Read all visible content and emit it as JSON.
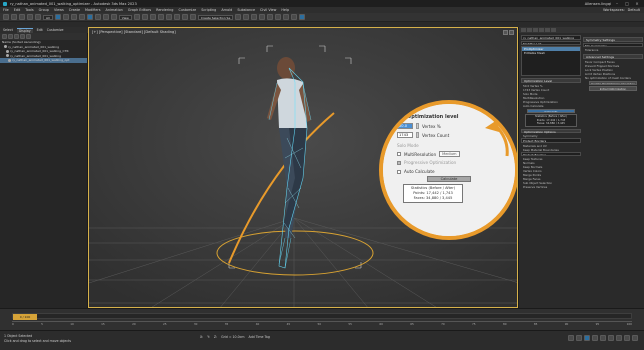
{
  "window": {
    "title": "ry_nathan_animated_001_walking_optimizer - Autodesk 3ds Max 2023",
    "user": "Allensen.lingqi"
  },
  "menu": [
    "File",
    "Edit",
    "Tools",
    "Group",
    "Views",
    "Create",
    "Modifiers",
    "Animation",
    "Graph Editors",
    "Rendering",
    "Customize",
    "Scripting",
    "Arnold",
    "Substance",
    "Civil View",
    "Help"
  ],
  "workspace": {
    "label": "Workspaces:",
    "value": "Default"
  },
  "toolbar": {
    "filter": "All",
    "view": "View",
    "selection_set": "Create Selection Se"
  },
  "left_tabs": [
    "Select",
    "Display",
    "Edit",
    "Customize"
  ],
  "scene_explorer": {
    "rows": [
      {
        "label": "Name (Sorted Ascending)",
        "selected": false
      },
      {
        "label": "ry_nathan_animated_001_walking",
        "selected": false
      },
      {
        "label": "ry_nathan_animated_001_walking_CTR",
        "selected": false
      },
      {
        "label": "ry_nathan_animated_001_walking",
        "selected": false
      },
      {
        "label": "ry_nathan_animated_001_walking_opt",
        "selected": true
      }
    ]
  },
  "viewport": {
    "label": "[+] [Perspective] [Standard] [Default Shading]"
  },
  "callout": {
    "heading": "Optimization level",
    "vertex_percent": {
      "value": "50.0",
      "label": "Vertex %"
    },
    "vertex_count": {
      "value": "1743",
      "label": "Vertex Count"
    },
    "solo_mode": "Solo Mode",
    "multires": {
      "label": "MultiResolution",
      "level": "Medium"
    },
    "progressive": "Progressive Optimization",
    "auto_calc": "Auto Calculate",
    "calc_button": "Calculate",
    "stats": {
      "title": "Statistics (Before / After)",
      "points": "Points: 17,442 / 1,743",
      "faces": "Faces: 34,880 / 3,445"
    }
  },
  "command_panel": {
    "object_name": "ry_nathan_animated_001_walking",
    "modifier_list": "Modifier List",
    "modifiers": [
      {
        "label": "ProOptimizer",
        "selected": true
      },
      {
        "label": "Editable Mesh",
        "selected": false
      }
    ],
    "rollouts": {
      "optimization": "Optimization Level",
      "vertex_pct_label": "Vertex %",
      "vertex_pct_value": "50.0",
      "vertex_count_label": "Vertex Count",
      "vertex_count_value": "1743",
      "solo_mode": "Solo Mode",
      "multires": "MultiResolution",
      "progressive": "Progressive Optimization",
      "auto_calc": "Auto Calculate",
      "calculate": "Calculate",
      "stats_title": "Statistics (Before / After)",
      "stats_points": "Points: 17,442 / 1,743",
      "stats_faces": "Faces: 34,880 / 3,445",
      "options": "Optimization Options",
      "symmetry_label": "Symmetry",
      "symmetry_value": "Protect Borders",
      "materials": "Materials and UV",
      "keep_mat": "Keep Material Boundaries",
      "protect": "Protect Borders",
      "keep_uv": "Keep Textures",
      "normals": "Normals",
      "keep_normals": "Keep Normals",
      "vertex_colors": "Vertex Colors",
      "merge": "Merge Points",
      "merge_faces": "Merge Faces",
      "sub_obj": "Sub Object Selection",
      "preserve": "Preserve Vertices"
    },
    "right": {
      "sym_settings": "Symmetry Settings",
      "axis": "Min Symmetry",
      "tolerance": "Tolerance",
      "advanced": "Advanced Settings",
      "favor_compact": "Favor Compact Faces",
      "prevent_flip": "Prevent Flipped Normals",
      "lock_vertex": "Lock Vertex Position",
      "limit_faces": "Limit Vertex Positions",
      "no_opt": "No optimization of mesh borders",
      "update_btn": "Update ProOptimizer Checkbox",
      "restore_btn": "Initial Optimization"
    }
  },
  "timeline": {
    "frame": "0 / 100",
    "ticks": [
      "0",
      "5",
      "10",
      "15",
      "20",
      "25",
      "30",
      "35",
      "40",
      "45",
      "50",
      "55",
      "60",
      "65",
      "70",
      "75",
      "80",
      "85",
      "90",
      "95",
      "100"
    ]
  },
  "status": {
    "selection": "1 Object Selected",
    "prompt": "Click and drag to select and move objects",
    "x": "X:",
    "y": "Y:",
    "z": "Z:",
    "grid": "Grid = 10.0cm",
    "tag": "Add Time Tag"
  }
}
